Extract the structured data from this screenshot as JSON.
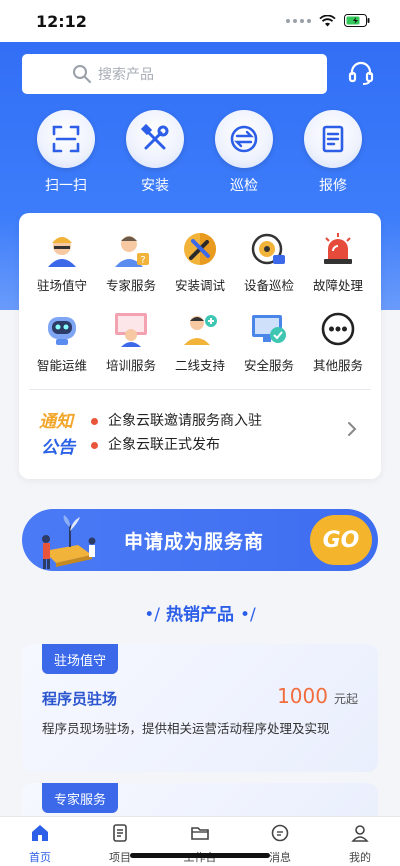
{
  "status_bar": {
    "time": "12:12"
  },
  "search": {
    "placeholder": "搜索产品"
  },
  "quick_actions": [
    {
      "label": "扫一扫",
      "icon": "scan-icon"
    },
    {
      "label": "安装",
      "icon": "tools-icon"
    },
    {
      "label": "巡检",
      "icon": "exchange-icon"
    },
    {
      "label": "报修",
      "icon": "report-icon"
    }
  ],
  "services": [
    {
      "label": "驻场值守",
      "icon": "onsite-guard-icon"
    },
    {
      "label": "专家服务",
      "icon": "expert-icon"
    },
    {
      "label": "安装调试",
      "icon": "install-debug-icon"
    },
    {
      "label": "设备巡检",
      "icon": "device-inspect-icon"
    },
    {
      "label": "故障处理",
      "icon": "alarm-icon"
    },
    {
      "label": "智能运维",
      "icon": "robot-icon"
    },
    {
      "label": "培训服务",
      "icon": "training-icon"
    },
    {
      "label": "二线支持",
      "icon": "support-icon"
    },
    {
      "label": "安全服务",
      "icon": "security-icon"
    },
    {
      "label": "其他服务",
      "icon": "more-icon"
    }
  ],
  "notice": {
    "logo_line1": "通知",
    "logo_line2": "公告",
    "items": [
      "企象云联邀请服务商入驻",
      "企象云联正式发布"
    ]
  },
  "banner": {
    "text": "申请成为服务商",
    "button": "GO"
  },
  "hot_section": {
    "title": "热销产品",
    "deco_left": "•/",
    "deco_right": "•/"
  },
  "products": [
    {
      "tag": "驻场值守",
      "name": "程序员驻场",
      "price": "1000",
      "unit": "元起",
      "desc": "程序员现场驻场，提供相关运营活动程序处理及实现"
    },
    {
      "tag": "专家服务"
    }
  ],
  "tabbar": [
    {
      "label": "首页",
      "icon": "home-icon",
      "active": true
    },
    {
      "label": "项目",
      "icon": "project-icon"
    },
    {
      "label": "工作台",
      "icon": "folder-icon"
    },
    {
      "label": "消息",
      "icon": "message-icon"
    },
    {
      "label": "我的",
      "icon": "user-icon"
    }
  ],
  "colors": {
    "primary": "#2f6bf5",
    "accent": "#f4b42b",
    "price": "#f26d3d",
    "notice_dot": "#e9553a"
  }
}
